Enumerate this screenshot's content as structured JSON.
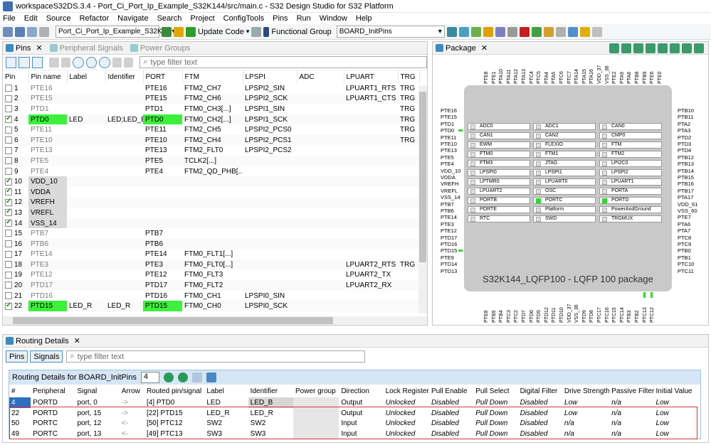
{
  "window": {
    "title": "workspaceS32DS.3.4 - Port_Ci_Port_Ip_Example_S32K144/src/main.c - S32 Design Studio for S32 Platform"
  },
  "menu": [
    "File",
    "Edit",
    "Source",
    "Refactor",
    "Navigate",
    "Search",
    "Project",
    "ConfigTools",
    "Pins",
    "Run",
    "Window",
    "Help"
  ],
  "toolbar": {
    "project_combo": "Port_Ci_Port_Ip_Example_S32K1...",
    "update_code": "Update Code",
    "functional_group_label": "Functional Group",
    "functional_group_value": "BOARD_InitPins"
  },
  "pins_panel": {
    "tabs": [
      "Pins",
      "Peripheral Signals",
      "Power Groups"
    ],
    "filter_placeholder": "type filter text",
    "columns": [
      "Pin",
      "Pin name",
      "Label",
      "Identifier",
      "PORT",
      "FTM",
      "LPSPI",
      "ADC",
      "LPUART",
      "TRG"
    ],
    "rows": [
      {
        "pin": "1",
        "name": "PTE16",
        "label": "",
        "id": "",
        "port": "PTE16",
        "ftm": "FTM2_CH7",
        "lpspi": "LPSPI2_SIN",
        "adc": "",
        "lpuart": "LPUART1_RTS",
        "trg": "TRG"
      },
      {
        "pin": "2",
        "name": "PTE15",
        "label": "",
        "id": "",
        "port": "PTE15",
        "ftm": "FTM2_CH6",
        "lpspi": "LPSPI2_SCK",
        "adc": "",
        "lpuart": "LPUART1_CTS",
        "trg": "TRG"
      },
      {
        "pin": "3",
        "name": "PTD1",
        "label": "",
        "id": "",
        "port": "PTD1",
        "ftm": "FTM0_CH3[...]",
        "lpspi": "LPSPI1_SIN",
        "adc": "",
        "lpuart": "",
        "trg": "TRG"
      },
      {
        "pin": "4",
        "name": "PTD0",
        "label": "LED",
        "id": "LED;LED_B",
        "port": "PTD0",
        "ftm": "FTM0_CH2[...]",
        "lpspi": "LPSPI1_SCK",
        "adc": "",
        "lpuart": "",
        "trg": "TRG"
      },
      {
        "pin": "5",
        "name": "PTE11",
        "label": "",
        "id": "",
        "port": "PTE11",
        "ftm": "FTM2_CH5",
        "lpspi": "LPSPI2_PCS0",
        "adc": "",
        "lpuart": "",
        "trg": "TRG"
      },
      {
        "pin": "6",
        "name": "PTE10",
        "label": "",
        "id": "",
        "port": "PTE10",
        "ftm": "FTM2_CH4",
        "lpspi": "LPSPI2_PCS1",
        "adc": "",
        "lpuart": "",
        "trg": "TRG"
      },
      {
        "pin": "7",
        "name": "PTE13",
        "label": "",
        "id": "",
        "port": "PTE13",
        "ftm": "FTM2_FLT0",
        "lpspi": "LPSPI2_PCS2",
        "adc": "",
        "lpuart": "",
        "trg": ""
      },
      {
        "pin": "8",
        "name": "PTE5",
        "label": "",
        "id": "",
        "port": "PTE5",
        "ftm": "TCLK2[...]",
        "lpspi": "",
        "adc": "",
        "lpuart": "",
        "trg": ""
      },
      {
        "pin": "9",
        "name": "PTE4",
        "label": "",
        "id": "",
        "port": "PTE4",
        "ftm": "FTM2_QD_PHB[...]",
        "lpspi": "",
        "adc": "",
        "lpuart": "",
        "trg": ""
      },
      {
        "pin": "10",
        "name": "VDD_10",
        "label": "",
        "id": "",
        "port": "",
        "ftm": "",
        "lpspi": "",
        "adc": "",
        "lpuart": "",
        "trg": ""
      },
      {
        "pin": "11",
        "name": "VDDA",
        "label": "",
        "id": "",
        "port": "",
        "ftm": "",
        "lpspi": "",
        "adc": "",
        "lpuart": "",
        "trg": ""
      },
      {
        "pin": "12",
        "name": "VREFH",
        "label": "",
        "id": "",
        "port": "",
        "ftm": "",
        "lpspi": "",
        "adc": "",
        "lpuart": "",
        "trg": ""
      },
      {
        "pin": "13",
        "name": "VREFL",
        "label": "",
        "id": "",
        "port": "",
        "ftm": "",
        "lpspi": "",
        "adc": "",
        "lpuart": "",
        "trg": ""
      },
      {
        "pin": "14",
        "name": "VSS_14",
        "label": "",
        "id": "",
        "port": "",
        "ftm": "",
        "lpspi": "",
        "adc": "",
        "lpuart": "",
        "trg": ""
      },
      {
        "pin": "15",
        "name": "PTB7",
        "label": "",
        "id": "",
        "port": "PTB7",
        "ftm": "",
        "lpspi": "",
        "adc": "",
        "lpuart": "",
        "trg": ""
      },
      {
        "pin": "16",
        "name": "PTB6",
        "label": "",
        "id": "",
        "port": "PTB6",
        "ftm": "",
        "lpspi": "",
        "adc": "",
        "lpuart": "",
        "trg": ""
      },
      {
        "pin": "17",
        "name": "PTE14",
        "label": "",
        "id": "",
        "port": "PTE14",
        "ftm": "FTM0_FLT1[...]",
        "lpspi": "",
        "adc": "",
        "lpuart": "",
        "trg": ""
      },
      {
        "pin": "18",
        "name": "PTE3",
        "label": "",
        "id": "",
        "port": "PTE3",
        "ftm": "FTM0_FLT0[...]",
        "lpspi": "",
        "adc": "",
        "lpuart": "LPUART2_RTS",
        "trg": "TRG"
      },
      {
        "pin": "19",
        "name": "PTE12",
        "label": "",
        "id": "",
        "port": "PTE12",
        "ftm": "FTM0_FLT3",
        "lpspi": "",
        "adc": "",
        "lpuart": "LPUART2_TX",
        "trg": ""
      },
      {
        "pin": "20",
        "name": "PTD17",
        "label": "",
        "id": "",
        "port": "PTD17",
        "ftm": "FTM0_FLT2",
        "lpspi": "",
        "adc": "",
        "lpuart": "LPUART2_RX",
        "trg": ""
      },
      {
        "pin": "21",
        "name": "PTD16",
        "label": "",
        "id": "",
        "port": "PTD16",
        "ftm": "FTM0_CH1",
        "lpspi": "LPSPI0_SIN",
        "adc": "",
        "lpuart": "",
        "trg": ""
      },
      {
        "pin": "22",
        "name": "PTD15",
        "label": "LED_R",
        "id": "LED_R",
        "port": "PTD15",
        "ftm": "FTM0_CH0",
        "lpspi": "LPSPI0_SCK",
        "adc": "",
        "lpuart": "",
        "trg": ""
      }
    ]
  },
  "package_panel": {
    "tab": "Package",
    "chip_label": "S32K144_LQFP100 - LQFP 100 package",
    "left_pins": [
      "PTE16",
      "PTE15",
      "PTD1",
      "PTD0",
      "PTE11",
      "PTE10",
      "PTE13",
      "PTE5",
      "PTE4",
      "VDD_10",
      "VDDA",
      "VREFH",
      "VREFL",
      "VSS_14",
      "PTB7",
      "PTB6",
      "PTE14",
      "PTE3",
      "PTE12",
      "PTD17",
      "PTD16",
      "PTD15",
      "PTE9",
      "PTD14",
      "PTD13"
    ],
    "right_pins": [
      "PTB10",
      "PTB11",
      "PTA2",
      "PTA3",
      "PTD2",
      "PTD3",
      "PTD4",
      "PTB12",
      "PTB13",
      "PTB14",
      "PTB15",
      "PTB16",
      "PTB17",
      "PTA17",
      "VDD_61",
      "VSS_60",
      "PTE7",
      "PTA6",
      "PTA7",
      "PTC8",
      "PTC9",
      "PTB0",
      "PTB1",
      "PTC10",
      "PTC11"
    ],
    "top_pins": [
      "PTE8",
      "PTE1",
      "PTA10",
      "PTA11",
      "PTA12",
      "PTA13",
      "PTC4",
      "PTC5",
      "PTA4",
      "PTA5",
      "PTC6",
      "PTC7",
      "PTA14",
      "PTA15",
      "PTA16",
      "VDD_37",
      "VSS_36",
      "PTE2",
      "PTA9",
      "PTA8",
      "PTB8",
      "PTB9",
      "PTE6",
      "PTE0"
    ],
    "bottom_pins": [
      "PTE8",
      "PTB5",
      "PTB4",
      "PTC3",
      "PTC2",
      "PTD7",
      "PTD6",
      "PTD5",
      "PTD12",
      "PTD11",
      "PTD10",
      "VDD_37",
      "VSS_36",
      "PTD9",
      "PTD8",
      "PTC17",
      "PTC16",
      "PTC15",
      "PTC14",
      "PTB3",
      "PTB2",
      "PTC13",
      "PTC12"
    ],
    "peripherals": [
      [
        "ADC0",
        "ADC1",
        "CAN0"
      ],
      [
        "CAN1",
        "CAN2",
        "CMP0"
      ],
      [
        "EWM",
        "FLEXIO",
        "FTM"
      ],
      [
        "FTM0",
        "FTM1",
        "FTM2"
      ],
      [
        "FTM3",
        "JTAG",
        "LPI2C0"
      ],
      [
        "LPSPI0",
        "LPSPI1",
        "LPSPI2"
      ],
      [
        "LPTMR0",
        "LPUART0",
        "LPUART1"
      ],
      [
        "LPUART2",
        "OSC",
        "PORTA"
      ],
      [
        "PORTB",
        "PORTC",
        "PORTD"
      ],
      [
        "PORTE",
        "Platform",
        "PowerAndGround"
      ],
      [
        "RTC",
        "SWD",
        "TRGMUX"
      ]
    ],
    "active_peripherals": [
      "PORTC",
      "PORTD"
    ]
  },
  "routing_panel": {
    "tab": "Routing Details",
    "buttons": [
      "Pins",
      "Signals"
    ],
    "filter_placeholder": "type filter text",
    "header_label": "Routing Details for BOARD_InitPins",
    "count": "4",
    "columns": [
      "#",
      "Peripheral",
      "Signal",
      "Arrow",
      "Routed pin/signal",
      "Label",
      "Identifier",
      "Power group",
      "Direction",
      "Lock Register",
      "Pull Enable",
      "Pull Select",
      "Digital Filter",
      "Drive Strength",
      "Passive Filter",
      "Initial Value"
    ],
    "rows": [
      [
        "4",
        "PORTD",
        "port, 0",
        "->",
        "[4] PTD0",
        "LED",
        "LED_B",
        "",
        "Output",
        "Unlocked",
        "Disabled",
        "Pull Down",
        "Disabled",
        "Low",
        "n/a",
        "Low"
      ],
      [
        "22",
        "PORTD",
        "port, 15",
        "->",
        "[22] PTD15",
        "LED_R",
        "LED_R",
        "",
        "Output",
        "Unlocked",
        "Disabled",
        "Pull Down",
        "Disabled",
        "Low",
        "n/a",
        "Low"
      ],
      [
        "50",
        "PORTC",
        "port, 12",
        "<-",
        "[50] PTC12",
        "SW2",
        "SW2",
        "",
        "Input",
        "Unlocked",
        "Disabled",
        "Pull Down",
        "Disabled",
        "n/a",
        "n/a",
        "Low"
      ],
      [
        "49",
        "PORTC",
        "port, 13",
        "<-",
        "[49] PTC13",
        "SW3",
        "SW3",
        "",
        "Input",
        "Unlocked",
        "Disabled",
        "Pull Down",
        "Disabled",
        "n/a",
        "n/a",
        "Low"
      ]
    ]
  }
}
